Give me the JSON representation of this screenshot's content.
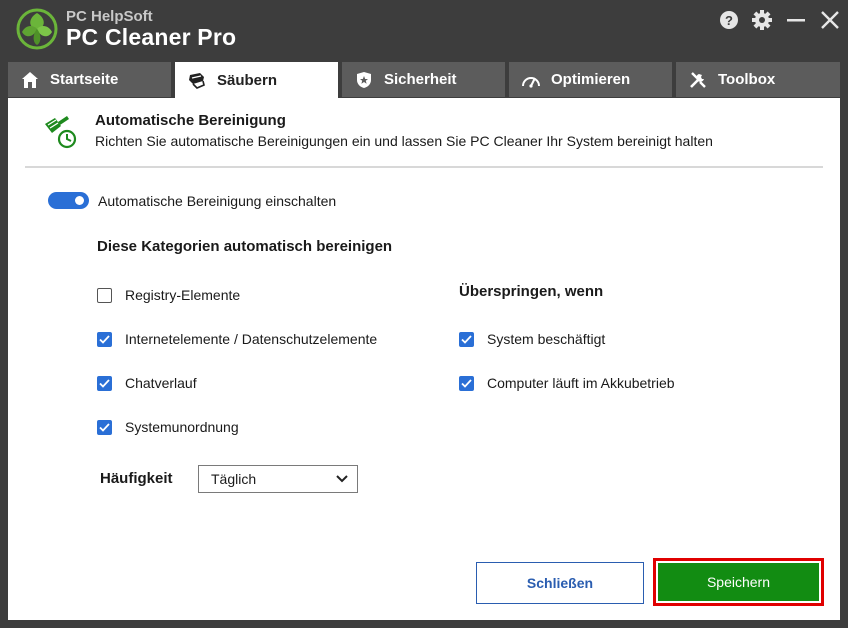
{
  "app": {
    "vendor": "PC HelpSoft",
    "product": "PC Cleaner Pro"
  },
  "window_controls": [
    "help-icon",
    "gear-icon",
    "minimize-icon",
    "close-icon"
  ],
  "tabs": [
    {
      "label": "Startseite",
      "icon": "home-icon",
      "active": false
    },
    {
      "label": "Säubern",
      "icon": "broom-icon",
      "active": true
    },
    {
      "label": "Sicherheit",
      "icon": "shield-icon",
      "active": false
    },
    {
      "label": "Optimieren",
      "icon": "speedometer-icon",
      "active": false
    },
    {
      "label": "Toolbox",
      "icon": "tools-icon",
      "active": false
    }
  ],
  "header": {
    "title": "Automatische Bereinigung",
    "subtitle": "Richten Sie automatische Bereinigungen ein und lassen Sie PC Cleaner Ihr System bereinigt halten",
    "icon": "broom-clock-icon"
  },
  "auto_toggle": {
    "label": "Automatische Bereinigung einschalten",
    "on": true
  },
  "categories": {
    "title": "Diese Kategorien automatisch bereinigen",
    "items": [
      {
        "label": "Registry-Elemente",
        "checked": false
      },
      {
        "label": "Internetelemente / Datenschutzelemente",
        "checked": true
      },
      {
        "label": "Chatverlauf",
        "checked": true
      },
      {
        "label": "Systemunordnung",
        "checked": true
      }
    ]
  },
  "skip": {
    "title": "Überspringen, wenn",
    "items": [
      {
        "label": "System beschäftigt",
        "checked": true
      },
      {
        "label": "Computer läuft im Akkubetrieb",
        "checked": true
      }
    ]
  },
  "frequency": {
    "label": "Häufigkeit",
    "selected": "Täglich"
  },
  "buttons": {
    "close": "Schließen",
    "save": "Speichern"
  },
  "colors": {
    "accent": "#2a6fd6",
    "save": "#128c12",
    "highlight": "#e00000",
    "titlebar": "#3d3d3d",
    "brand_green": "#6bb53a"
  }
}
